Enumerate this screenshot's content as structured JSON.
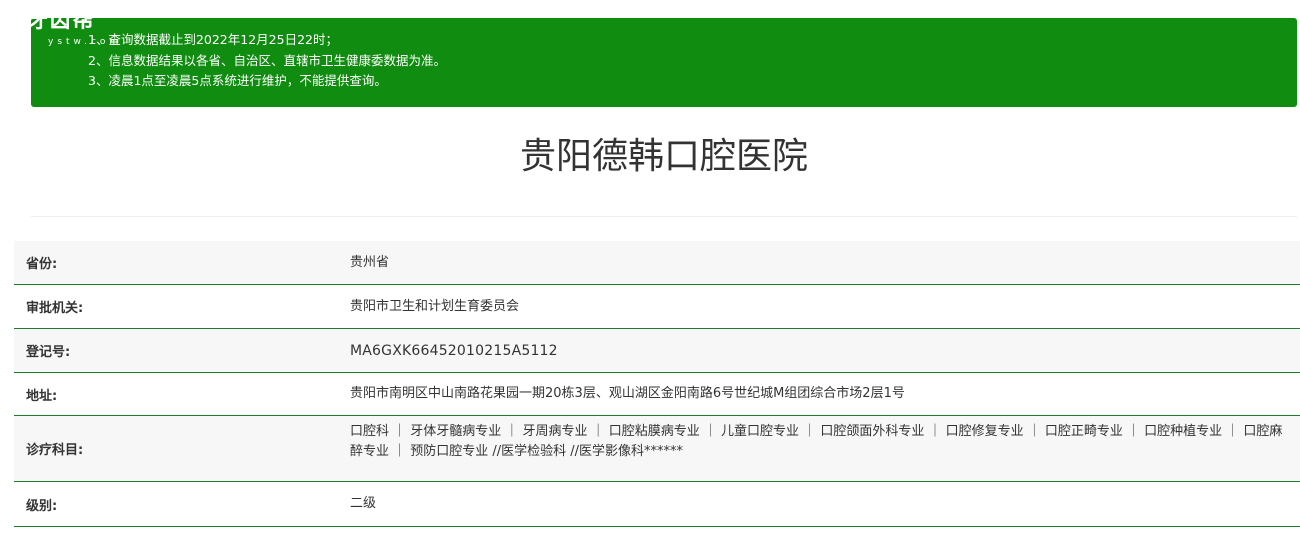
{
  "watermark": {
    "brand": "牙齿帮",
    "domain": "ystw.com"
  },
  "notice": {
    "lines": [
      "1、查询数据截止到2022年12月25日22时；",
      "2、信息数据结果以各省、自治区、直辖市卫生健康委数据为准。",
      "3、凌晨1点至凌晨5点系统进行维护，不能提供查询。"
    ],
    "background": "#108c10"
  },
  "hospital": {
    "name": "贵阳德韩口腔医院"
  },
  "details": [
    {
      "label": "省份:",
      "value": "贵州省"
    },
    {
      "label": "审批机关:",
      "value": "贵阳市卫生和计划生育委员会"
    },
    {
      "label": "登记号:",
      "value": "MA6GXK66452010215A5112"
    },
    {
      "label": "地址:",
      "value": "贵阳市南明区中山南路花果园一期20栋3层、观山湖区金阳南路6号世纪城M组团综合市场2层1号"
    },
    {
      "label": "诊疗科目:",
      "value": "口腔科 ｜ 牙体牙髓病专业 ｜ 牙周病专业 ｜ 口腔粘膜病专业 ｜ 儿童口腔专业 ｜ 口腔颌面外科专业 ｜ 口腔修复专业 ｜ 口腔正畸专业 ｜ 口腔种植专业 ｜ 口腔麻醉专业 ｜ 预防口腔专业 //医学检验科 //医学影像科******"
    },
    {
      "label": "级别:",
      "value": "二级"
    }
  ],
  "colors": {
    "row_border": "#1c7a2c",
    "row_alt": "#f7f7f7"
  }
}
